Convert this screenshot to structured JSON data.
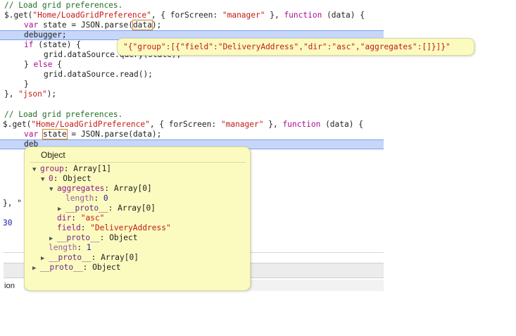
{
  "code1": {
    "comment": "// Load grid preferences.",
    "get_prefix": "$.get(",
    "url": "\"Home/LoadGridPreference\"",
    "middle1": ", { forScreen: ",
    "screen_str": "\"manager\"",
    "middle2": " }, ",
    "kw_function": "function",
    "fn_args": " (data) {",
    "var_kw": "var",
    "var_rest1": " state = JSON.parse(",
    "data_token": "data",
    "var_rest2": ");",
    "debugger": "debugger;",
    "if_kw": "if",
    "if_rest": " (state) {",
    "query_line": "grid.dataSource.query(state);",
    "else_open": "} ",
    "else_kw": "else",
    "else_rest": " {",
    "read_line": "grid.dataSource.read();",
    "close_brace": "}",
    "end_prefix": "}, ",
    "json_str": "\"json\"",
    "end_suffix": ");"
  },
  "code2": {
    "comment": "// Load grid preferences.",
    "get_prefix": "$.get(",
    "url": "\"Home/LoadGridPreference\"",
    "middle1": ", { forScreen: ",
    "screen_str": "\"manager\"",
    "middle2": " }, ",
    "kw_function": "function",
    "fn_args": " (data) {",
    "var_kw": "var",
    "state_token": "state",
    "var_rest": " = JSON.parse(data);",
    "debugger_partial": "deb",
    "end_partial": "}, \"",
    "number_partial": "30",
    "console_partial": "ion"
  },
  "tooltip1": {
    "value": "\"{\"group\":[{\"field\":\"DeliveryAddress\",\"dir\":\"asc\",\"aggregates\":[]}]}\""
  },
  "tooltip2": {
    "title": "Object",
    "tree": {
      "group_key": "group",
      "group_val": ": Array[1]",
      "item0_key": "0",
      "item0_val": ": Object",
      "aggregates_key": "aggregates",
      "aggregates_val": ": Array[0]",
      "length_key": "length",
      "length_zero": "0",
      "proto_key": "__proto__",
      "proto_array_val": ": Array[0]",
      "dir_key": "dir",
      "dir_val": "\"asc\"",
      "field_key": "field",
      "field_val": "\"DeliveryAddress\"",
      "proto_object_val": ": Object",
      "length_one": "1"
    }
  }
}
